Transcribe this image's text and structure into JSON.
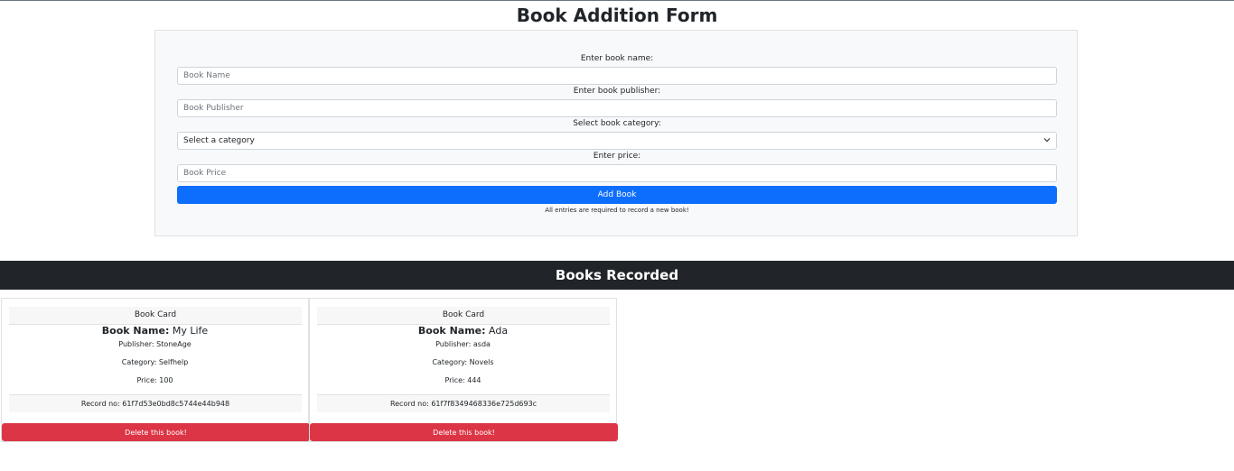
{
  "page": {
    "title": "Book Addition Form"
  },
  "form": {
    "name_label": "Enter book name:",
    "name_placeholder": "Book Name",
    "publisher_label": "Enter book publisher:",
    "publisher_placeholder": "Book Publisher",
    "category_label": "Select book category:",
    "category_selected": "Select a category",
    "price_label": "Enter price:",
    "price_placeholder": "Book Price",
    "submit_label": "Add Book",
    "note": "All entries are required to record a new book!"
  },
  "books_section": {
    "title": "Books Recorded"
  },
  "books": [
    {
      "header": "Book Card",
      "name_prefix": "Book Name:",
      "name": "My Life",
      "publisher": "Publisher: StoneAge",
      "category": "Category: Selfhelp",
      "price": "Price: 100",
      "record": "Record no: 61f7d53e0bd8c5744e44b948",
      "delete_label": "Delete this book!"
    },
    {
      "header": "Book Card",
      "name_prefix": "Book Name:",
      "name": "Ada",
      "publisher": "Publisher: asda",
      "category": "Category: Novels",
      "price": "Price: 444",
      "record": "Record no: 61f7f8349468336e725d693c",
      "delete_label": "Delete this book!"
    }
  ],
  "colors": {
    "primary": "#0d6efd",
    "danger": "#dc3545",
    "dark": "#212529",
    "light": "#f8f9fa"
  },
  "icons": {
    "select_chevron": "chevron-down-icon"
  }
}
